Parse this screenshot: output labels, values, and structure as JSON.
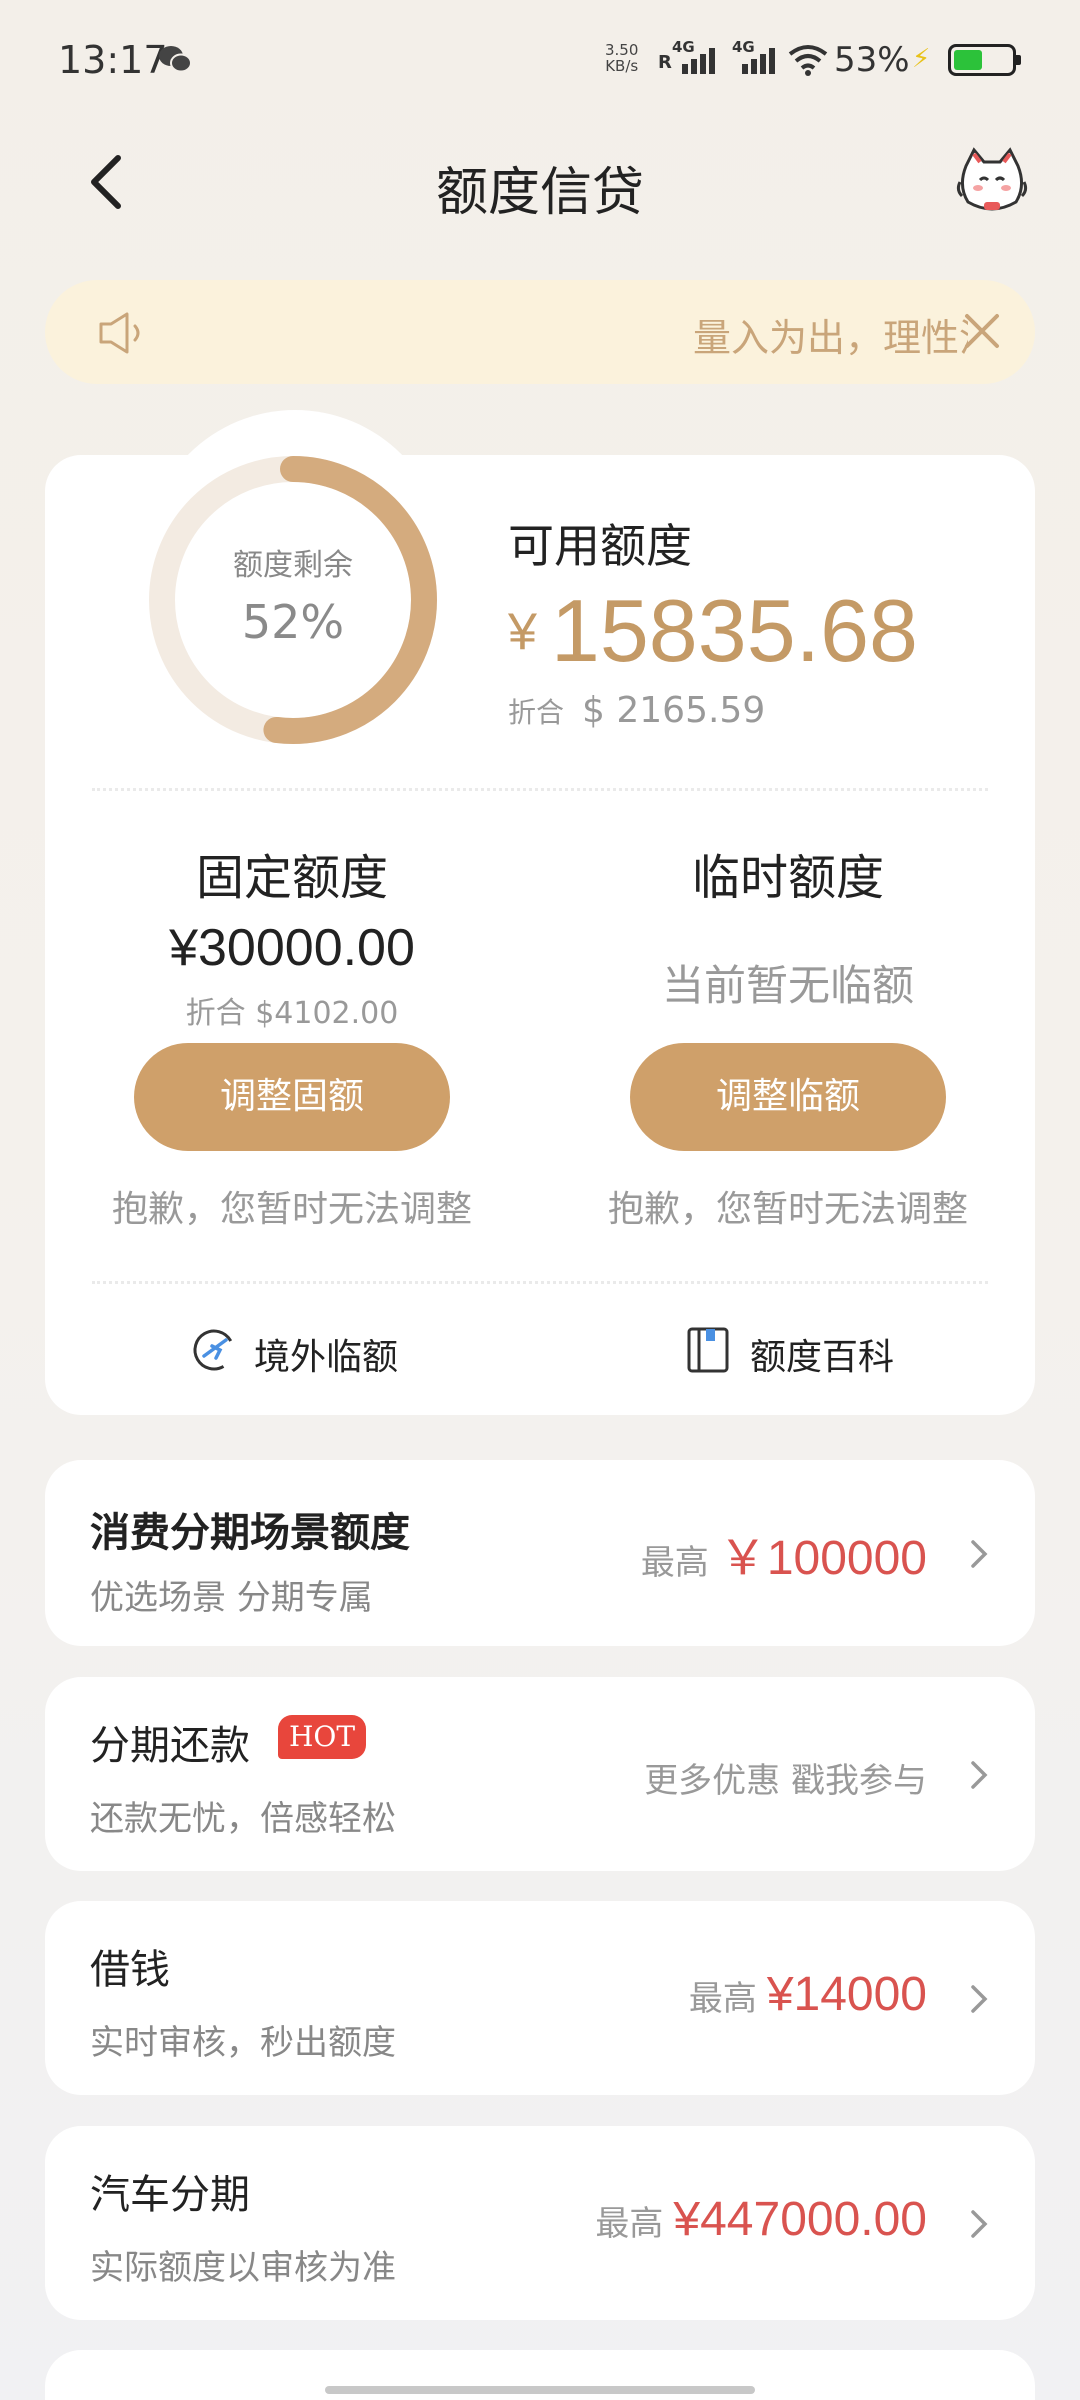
{
  "status": {
    "time": "13:17",
    "net_speed_value": "3.50",
    "net_speed_unit": "KB/s",
    "sim1": "4G",
    "sim2": "4G",
    "roaming": "R",
    "battery_pct": "53%"
  },
  "header": {
    "title": "额度信贷"
  },
  "notice": {
    "text": "量入为出，理性消费"
  },
  "summary": {
    "ring_label": "额度剩余",
    "ring_percent": "52%",
    "ring_fraction": 0.52,
    "available_title": "可用额度",
    "currency_symbol": "¥",
    "available_amount": "15835.68",
    "usd_prefix": "折合",
    "usd_amount": "$ 2165.59",
    "accent_color": "#cfa06a"
  },
  "fixed": {
    "title": "固定额度",
    "amount": "¥30000.00",
    "usd": "折合 $4102.00",
    "button": "调整固额",
    "note": "抱歉，您暂时无法调整"
  },
  "temp": {
    "title": "临时额度",
    "none_text": "当前暂无临额",
    "button": "调整临额",
    "note": "抱歉，您暂时无法调整"
  },
  "links": {
    "overseas": "境外临额",
    "wiki": "额度百科"
  },
  "rows": [
    {
      "title": "消费分期场景额度",
      "subtitle": "优选场景 分期专属",
      "prefix": "最高",
      "amount": "￥100000"
    },
    {
      "title": "分期还款",
      "badge": "HOT",
      "subtitle": "还款无忧，倍感轻松",
      "right_text": "更多优惠 戳我参与"
    },
    {
      "title": "借钱",
      "subtitle": "实时审核，秒出额度",
      "prefix": "最高",
      "amount": "¥14000"
    },
    {
      "title": "汽车分期",
      "subtitle": "实际额度以审核为准",
      "prefix": "最高",
      "amount": "¥447000.00"
    }
  ],
  "icons": {
    "back": "chevron-left-icon",
    "mascot": "cat-mascot-icon",
    "speaker": "speaker-icon",
    "close": "close-icon",
    "overseas": "plane-globe-icon",
    "wiki": "book-icon"
  }
}
